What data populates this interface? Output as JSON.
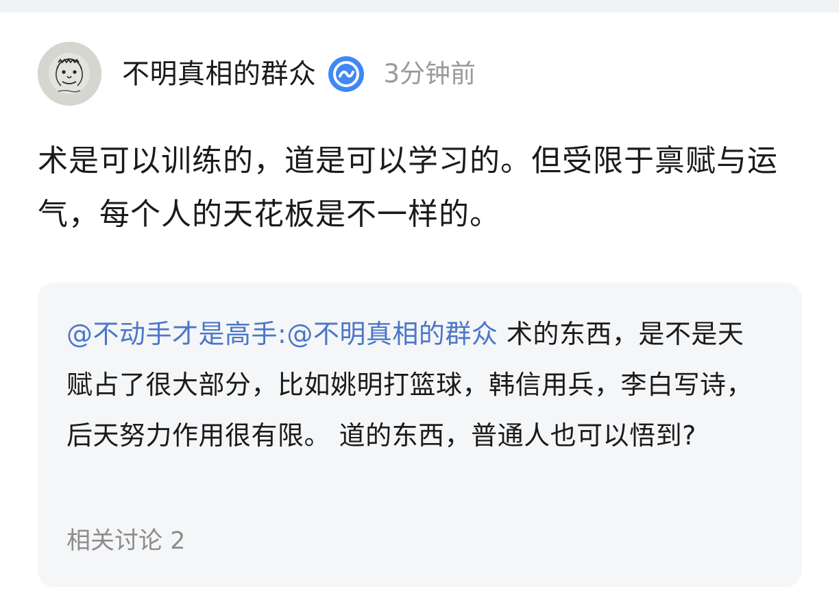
{
  "post": {
    "author": {
      "name": "不明真相的群众",
      "verified_badge_icon": "verified-icon",
      "badge_color": "#3f88f5"
    },
    "time": "3分钟前",
    "content": "术是可以训练的，道是可以学习的。但受限于禀赋与运气，每个人的天花板是不一样的。"
  },
  "quote": {
    "mention_1": "@不动手才是高手",
    "separator": ":",
    "mention_2": "@不明真相的群众",
    "text": " 术的东西，是不是天赋占了很大部分，比如姚明打篮球，韩信用兵，李白写诗，后天努力作用很有限。 道的东西，普通人也可以悟到?",
    "mention_color": "#4a77c9"
  },
  "related": {
    "label": "相关讨论 2"
  }
}
